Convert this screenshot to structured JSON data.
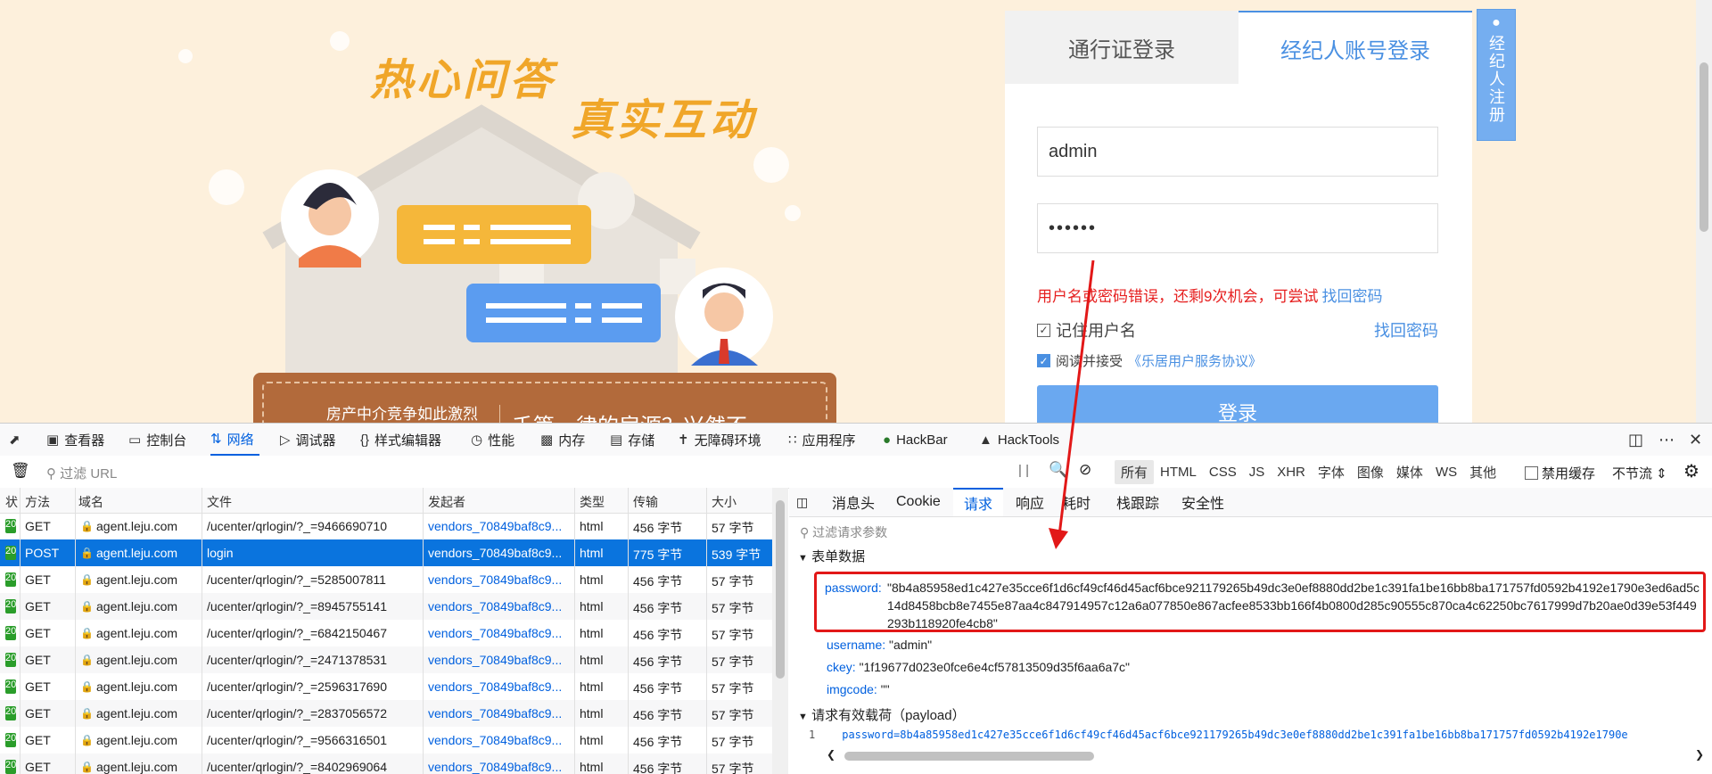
{
  "page": {
    "slogan_1": "热心问答",
    "slogan_2": "真实互动",
    "banner_text_1": "房产中介竞争如此激烈",
    "banner_text_2": "千篇一律的房源？兴然不",
    "login": {
      "tab_passport": "通行证登录",
      "tab_agent": "经纪人账号登录",
      "username_value": "admin",
      "password_value": "••••••",
      "error_text": "用户名或密码错误，还剩9次机会，可尝试",
      "error_link": "找回密码",
      "remember_label": "记住用户名",
      "forgot_link": "找回密码",
      "agree_prefix": "阅读并接受",
      "agree_link": "《乐居用户服务协议》",
      "login_button": "登录"
    },
    "register_side": "经纪人注册"
  },
  "devtools": {
    "tabs": [
      {
        "label": "查看器",
        "icon": "inspector-icon"
      },
      {
        "label": "控制台",
        "icon": "console-icon"
      },
      {
        "label": "网络",
        "icon": "network-icon"
      },
      {
        "label": "调试器",
        "icon": "debugger-icon"
      },
      {
        "label": "样式编辑器",
        "icon": "style-editor-icon"
      },
      {
        "label": "性能",
        "icon": "performance-icon"
      },
      {
        "label": "内存",
        "icon": "memory-icon"
      },
      {
        "label": "存储",
        "icon": "storage-icon"
      },
      {
        "label": "无障碍环境",
        "icon": "accessibility-icon"
      },
      {
        "label": "应用程序",
        "icon": "application-icon"
      },
      {
        "label": "HackBar",
        "icon": "hackbar-icon"
      },
      {
        "label": "HackTools",
        "icon": "hacktools-icon"
      }
    ],
    "filter_url_placeholder": "过滤 URL",
    "type_filters": [
      "所有",
      "HTML",
      "CSS",
      "JS",
      "XHR",
      "字体",
      "图像",
      "媒体",
      "WS",
      "其他"
    ],
    "disable_cache": "禁用缓存",
    "throttle": "不节流 ⇕",
    "columns": [
      "状",
      "方法",
      "域名",
      "文件",
      "发起者",
      "类型",
      "传输",
      "大小"
    ],
    "requests": [
      {
        "status": "20",
        "method": "GET",
        "domain": "agent.leju.com",
        "file": "/ucenter/qrlogin/?_=9466690710",
        "initiator": "vendors_70849baf8c9...",
        "type": "html",
        "transfer": "456 字节",
        "size": "57 字节"
      },
      {
        "status": "20",
        "method": "POST",
        "domain": "agent.leju.com",
        "file": "login",
        "initiator": "vendors_70849baf8c9...",
        "type": "html",
        "transfer": "775 字节",
        "size": "539 字节"
      },
      {
        "status": "20",
        "method": "GET",
        "domain": "agent.leju.com",
        "file": "/ucenter/qrlogin/?_=5285007811",
        "initiator": "vendors_70849baf8c9...",
        "type": "html",
        "transfer": "456 字节",
        "size": "57 字节"
      },
      {
        "status": "20",
        "method": "GET",
        "domain": "agent.leju.com",
        "file": "/ucenter/qrlogin/?_=8945755141",
        "initiator": "vendors_70849baf8c9...",
        "type": "html",
        "transfer": "456 字节",
        "size": "57 字节"
      },
      {
        "status": "20",
        "method": "GET",
        "domain": "agent.leju.com",
        "file": "/ucenter/qrlogin/?_=6842150467",
        "initiator": "vendors_70849baf8c9...",
        "type": "html",
        "transfer": "456 字节",
        "size": "57 字节"
      },
      {
        "status": "20",
        "method": "GET",
        "domain": "agent.leju.com",
        "file": "/ucenter/qrlogin/?_=2471378531",
        "initiator": "vendors_70849baf8c9...",
        "type": "html",
        "transfer": "456 字节",
        "size": "57 字节"
      },
      {
        "status": "20",
        "method": "GET",
        "domain": "agent.leju.com",
        "file": "/ucenter/qrlogin/?_=2596317690",
        "initiator": "vendors_70849baf8c9...",
        "type": "html",
        "transfer": "456 字节",
        "size": "57 字节"
      },
      {
        "status": "20",
        "method": "GET",
        "domain": "agent.leju.com",
        "file": "/ucenter/qrlogin/?_=2837056572",
        "initiator": "vendors_70849baf8c9...",
        "type": "html",
        "transfer": "456 字节",
        "size": "57 字节"
      },
      {
        "status": "20",
        "method": "GET",
        "domain": "agent.leju.com",
        "file": "/ucenter/qrlogin/?_=9566316501",
        "initiator": "vendors_70849baf8c9...",
        "type": "html",
        "transfer": "456 字节",
        "size": "57 字节"
      },
      {
        "status": "20",
        "method": "GET",
        "domain": "agent.leju.com",
        "file": "/ucenter/qrlogin/?_=8402969064",
        "initiator": "vendors_70849baf8c9...",
        "type": "html",
        "transfer": "456 字节",
        "size": "57 字节"
      }
    ],
    "detail_tabs": [
      "消息头",
      "Cookie",
      "请求",
      "响应",
      "耗时",
      "栈跟踪",
      "安全性"
    ],
    "param_filter_placeholder": "过滤请求参数",
    "form_section": "表单数据",
    "form": {
      "password_key": "password:",
      "password_value": "\"8b4a85958ed1c427e35cce6f1d6cf49cf46d45acf6bce921179265b49dc3e0ef8880dd2be1c391fa1be16bb8ba171757fd0592b4192e1790e3ed6ad5c14d8458bcb8e7455e87aa4c847914957c12a6a077850e867acfee8533bb166f4b0800d285c90555c870ca4c62250bc7617999d7b20ae0d39e53f449293b118920fe4cb8\"",
      "username_key": "username:",
      "username_value": "\"admin\"",
      "ckey_key": "ckey:",
      "ckey_value": "\"1f19677d023e0fce6e4cf57813509d35f6aa6a7c\"",
      "imgcode_key": "imgcode:",
      "imgcode_value": "\"\""
    },
    "payload_section": "请求有效载荷（payload）",
    "payload_line_no": "1",
    "payload_text": "password=8b4a85958ed1c427e35cce6f1d6cf49cf46d45acf6bce921179265b49dc3e0ef8880dd2be1c391fa1be16bb8ba171757fd0592b4192e1790e"
  },
  "colors": {
    "accent": "#0060df",
    "selected_row": "#0a74de",
    "annotation_red": "#e21818",
    "login_blue": "#4a90e2",
    "page_bg": "#fdf0dc"
  }
}
